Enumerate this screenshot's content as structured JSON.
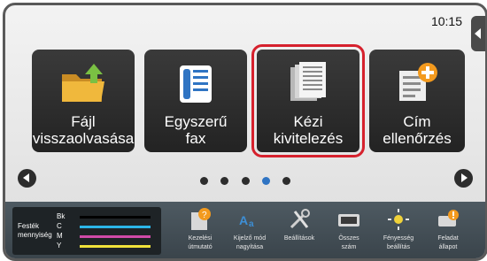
{
  "status": {
    "clock": "10:15"
  },
  "tiles": [
    {
      "id": "file-retrieve",
      "label_line1": "Fájl",
      "label_line2": "visszaolvasása",
      "icon": "folder-upload-icon"
    },
    {
      "id": "easy-fax",
      "label_line1": "Egyszerű",
      "label_line2": "fax",
      "icon": "fax-phone-icon"
    },
    {
      "id": "manual-finish",
      "label_line1": "Kézi",
      "label_line2": "kivitelezés",
      "icon": "document-stack-icon"
    },
    {
      "id": "address-check",
      "label_line1": "Cím",
      "label_line2": "ellenőrzés",
      "icon": "address-book-plus-icon"
    }
  ],
  "pagination": {
    "total": 5,
    "active_index": 3,
    "accent": "#2f74c3"
  },
  "toner": {
    "title_line1": "Festék",
    "title_line2": "mennyiség",
    "rows": [
      {
        "label": "Bk",
        "color": "#000000"
      },
      {
        "label": "C",
        "color": "#2bb5e8"
      },
      {
        "label": "M",
        "color": "#d04aa8"
      },
      {
        "label": "Y",
        "color": "#f0e23a"
      }
    ]
  },
  "bottom_icons": [
    {
      "line1": "Kezelési",
      "line2": "útmutató",
      "icon": "manual-book-icon"
    },
    {
      "line1": "Kijelző mód",
      "line2": "nagyítása",
      "icon": "magnify-text-icon"
    },
    {
      "line1": "Beállítások",
      "line2": "",
      "icon": "tools-icon"
    },
    {
      "line1": "Összes",
      "line2": "szám",
      "icon": "counter-icon"
    },
    {
      "line1": "Fényesség",
      "line2": "beállítás",
      "icon": "brightness-icon"
    },
    {
      "line1": "Feladat",
      "line2": "állapot",
      "icon": "job-status-icon"
    }
  ],
  "colors": {
    "highlight": "#d6212d",
    "tile_bg": "#2c2c2c"
  }
}
